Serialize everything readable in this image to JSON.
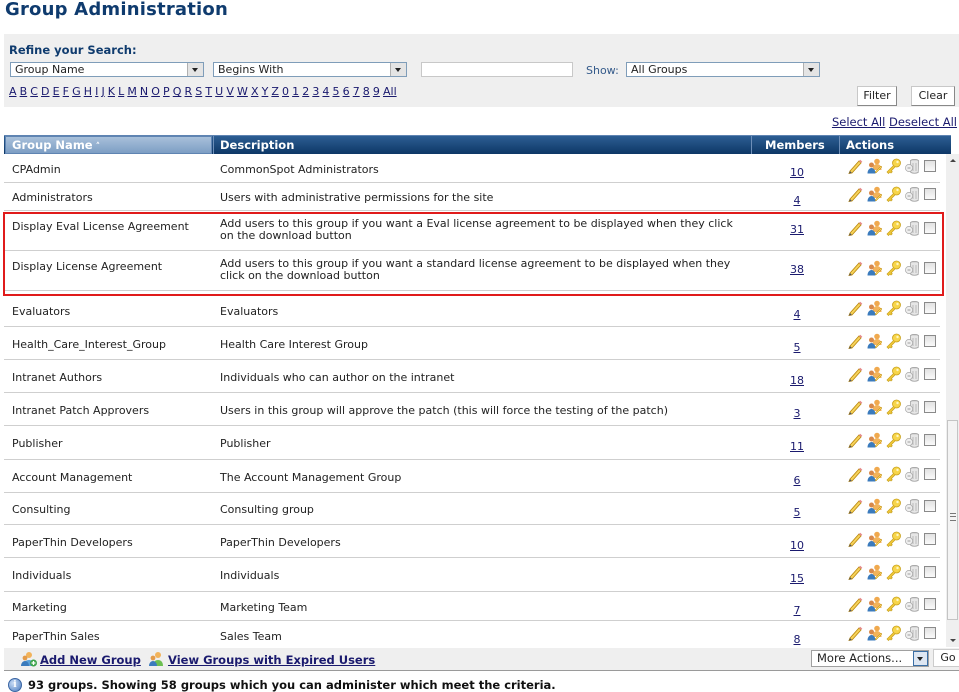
{
  "page_title": "Group Administration",
  "search": {
    "refine_label": "Refine your Search:",
    "field_select": "Group Name",
    "match_select": "Begins With",
    "search_value": "",
    "show_label": "Show:",
    "show_select": "All Groups",
    "alphabet": [
      "A",
      "B",
      "C",
      "D",
      "E",
      "F",
      "G",
      "H",
      "I",
      "J",
      "K",
      "L",
      "M",
      "N",
      "O",
      "P",
      "Q",
      "R",
      "S",
      "T",
      "U",
      "V",
      "W",
      "X",
      "Y",
      "Z",
      "0",
      "1",
      "2",
      "3",
      "4",
      "5",
      "6",
      "7",
      "8",
      "9",
      "All"
    ],
    "filter_button": "Filter",
    "clear_button": "Clear"
  },
  "selection": {
    "select_all": "Select All",
    "deselect_all": "Deselect All"
  },
  "table": {
    "columns": {
      "name": "Group Name",
      "description": "Description",
      "members": "Members",
      "actions": "Actions"
    },
    "sort_indicator": "^",
    "rows": [
      {
        "name": "CPAdmin",
        "description": "CommonSpot Administrators",
        "members": "10"
      },
      {
        "name": "Administrators",
        "description": "Users with administrative permissions for the site",
        "members": "4"
      },
      {
        "name": "Display Eval License Agreement",
        "description": "Add users to this group if you want a Eval license agreement to be displayed when they click on the download button",
        "members": "31"
      },
      {
        "name": "Display License Agreement",
        "description": "Add users to this group if you want a standard license agreement to be displayed when they click on the download button",
        "members": "38"
      },
      {
        "name": "Evaluators",
        "description": "Evaluators",
        "members": "4"
      },
      {
        "name": "Health_Care_Interest_Group",
        "description": "Health Care Interest Group",
        "members": "5"
      },
      {
        "name": "Intranet Authors",
        "description": "Individuals who can author on the intranet",
        "members": "18"
      },
      {
        "name": "Intranet Patch Approvers",
        "description": "Users in this group will approve the patch (this will force the testing of the patch)",
        "members": "3"
      },
      {
        "name": "Publisher",
        "description": "Publisher",
        "members": "11"
      },
      {
        "name": "Account Management",
        "description": "The Account Management Group",
        "members": "6"
      },
      {
        "name": "Consulting",
        "description": "Consulting group",
        "members": "5"
      },
      {
        "name": "PaperThin Developers",
        "description": "PaperThin Developers",
        "members": "10"
      },
      {
        "name": "Individuals",
        "description": "Individuals",
        "members": "15"
      },
      {
        "name": "Marketing",
        "description": "Marketing Team",
        "members": "7"
      },
      {
        "name": "PaperThin Sales",
        "description": "Sales Team",
        "members": "8"
      }
    ],
    "action_icons": [
      "edit-pencil-icon",
      "manage-members-icon",
      "permissions-key-icon",
      "delete-trash-icon",
      "select-checkbox"
    ]
  },
  "footer": {
    "add_group": "Add New Group",
    "view_expired": "View Groups with Expired Users",
    "more_actions": "More Actions...",
    "go_button": "Go"
  },
  "status_message": "93 groups. Showing 58 groups which you can administer which meet the criteria.",
  "colors": {
    "title": "#0f3b6e",
    "header_bg": "#0d3766",
    "highlight_border": "#e01b1b",
    "link": "#1a1a6e"
  }
}
